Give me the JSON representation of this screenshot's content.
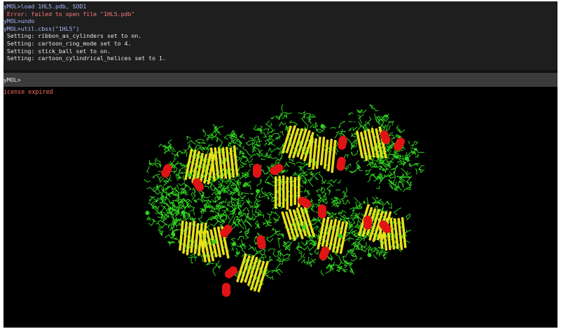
{
  "log": {
    "lines": [
      {
        "text": "yMOL>load 1HL5.pdb, SOD1",
        "kind": "cmd"
      },
      {
        "text": " Error: failed to open file \"1HL5.pdb\"",
        "kind": "err"
      },
      {
        "text": "yMOL>undo",
        "kind": "cmd"
      },
      {
        "text": "yMOL>util.cbss(\"1HL5\")",
        "kind": "cmd"
      },
      {
        "text": " Setting: ribbon_as_cylinders set to on.",
        "kind": "set"
      },
      {
        "text": " Setting: cartoon_ring_mode set to 4.",
        "kind": "set"
      },
      {
        "text": " Setting: stick_ball set to on.",
        "kind": "set"
      },
      {
        "text": " Setting: cartoon_cylindrical_helices set to 1.",
        "kind": "set"
      }
    ]
  },
  "command": {
    "prompt": "yMOL>",
    "value": ""
  },
  "viewer": {
    "license_text": "icense expired",
    "colors": {
      "background": "#000000",
      "sticks": "#2fd21f",
      "sheets": "#e8e01a",
      "helices": "#e01414"
    }
  }
}
